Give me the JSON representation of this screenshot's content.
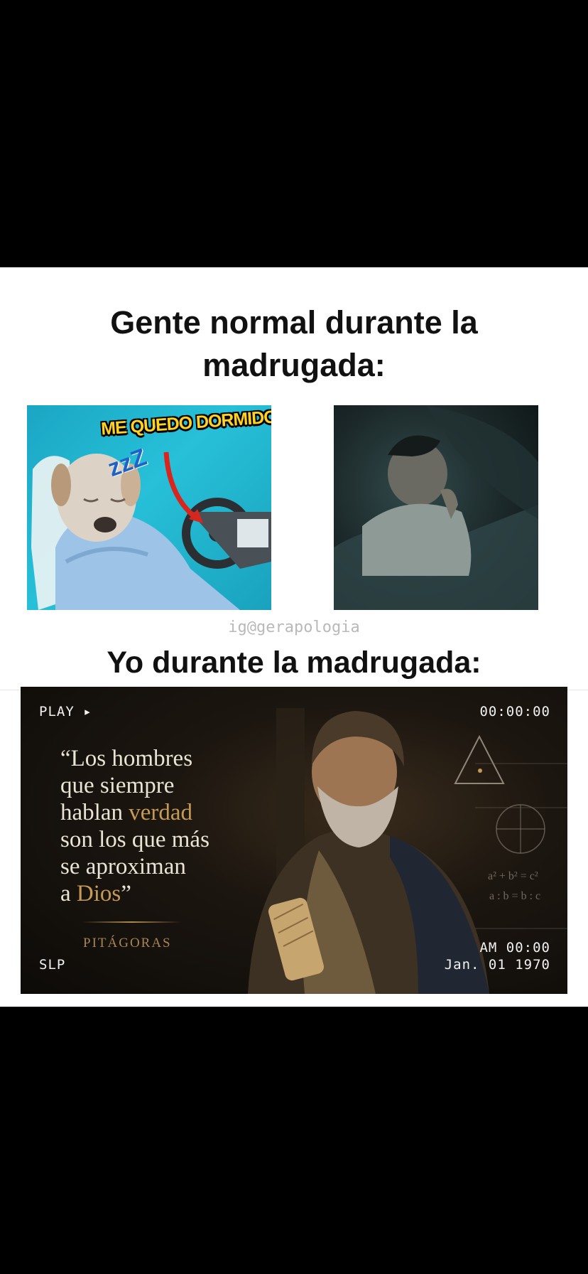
{
  "headings": {
    "top": "Gente normal durante la madrugada:",
    "bottom": "Yo durante la madrugada:"
  },
  "dog_panel": {
    "caption": "ME QUEDO DORMIDO",
    "zzz": "zzZ"
  },
  "watermark": "ig@gerapologia",
  "quote_panel": {
    "play_label": "PLAY ▸",
    "timecode": "00:00:00",
    "slp_label": "SLP",
    "am_time": "AM 00:00",
    "date": "Jan. 01 1970",
    "quote": {
      "open": "“Los hombres\nque siempre\nhablan ",
      "accent_1": "verdad",
      "middle": "\nson los que más\nse aproximan\na ",
      "accent_2": "Dios",
      "close": "”"
    },
    "author": "PITÁGORAS",
    "math": {
      "pythagorean": "a² + b² = c²",
      "ratio": "a : b = b : c"
    }
  },
  "colors": {
    "background": "#000000",
    "card": "#ffffff",
    "caption_yellow": "#ffd21f",
    "quote_accent": "#c59a55"
  }
}
